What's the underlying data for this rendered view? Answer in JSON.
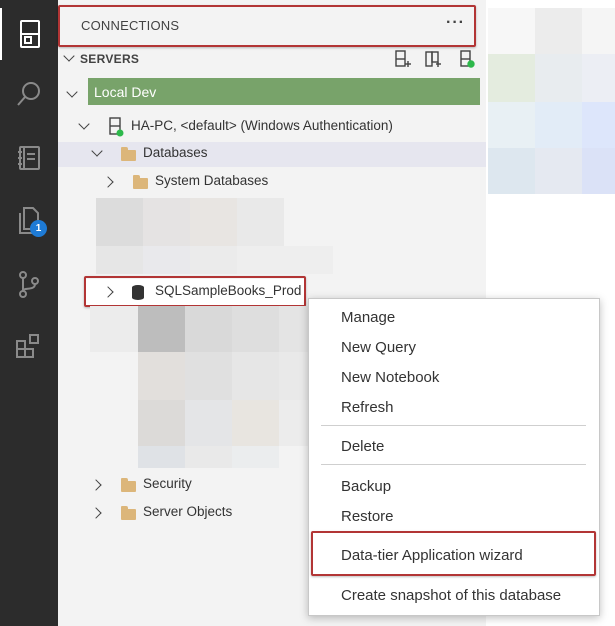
{
  "activity_bar": {
    "items": [
      {
        "icon": "connections-icon",
        "active": true
      },
      {
        "icon": "search-icon",
        "active": false
      },
      {
        "icon": "notebook-icon",
        "active": false
      },
      {
        "icon": "explorer-icon",
        "active": false,
        "badge": "1"
      },
      {
        "icon": "source-control-icon",
        "active": false
      },
      {
        "icon": "extensions-icon",
        "active": false
      }
    ]
  },
  "panel": {
    "title": "CONNECTIONS",
    "more_label": "···",
    "section_title": "SERVERS",
    "section_actions": [
      "new-connection-icon",
      "new-server-group-icon",
      "active-connections-icon"
    ]
  },
  "tree": {
    "group": "Local Dev",
    "server": "HA-PC, <default> (Windows Authentication)",
    "databases": "Databases",
    "system_databases": "System Databases",
    "selected_db": "SQLSampleBooks_Prod",
    "security": "Security",
    "server_objects": "Server Objects"
  },
  "context_menu": {
    "items": [
      "Manage",
      "New Query",
      "New Notebook",
      "Refresh",
      "Delete",
      "Backup",
      "Restore",
      "Data-tier Application wizard",
      "Create snapshot of this database"
    ]
  },
  "colors": {
    "activity_bar": "#2c2c2c",
    "panel_bg": "#f3f3f3",
    "group_bg": "#78a36a",
    "highlight_box": "#b23535",
    "badge": "#1e7bd6"
  }
}
